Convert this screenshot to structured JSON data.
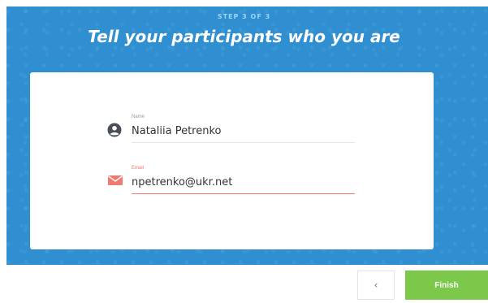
{
  "header": {
    "step_text": "STEP 3 OF 3",
    "title": "Tell your participants who you are"
  },
  "form": {
    "name": {
      "label": "Name",
      "value": "Nataliia Petrenko",
      "icon": "user-circle-icon"
    },
    "email": {
      "label": "Email",
      "value": "npetrenko@ukr.net",
      "icon": "envelope-icon"
    }
  },
  "footer": {
    "back_label": "‹",
    "finish_label": "Finish"
  },
  "colors": {
    "background": "#2f8fd0",
    "accent": "#7cc84b",
    "error": "#f07a72"
  }
}
